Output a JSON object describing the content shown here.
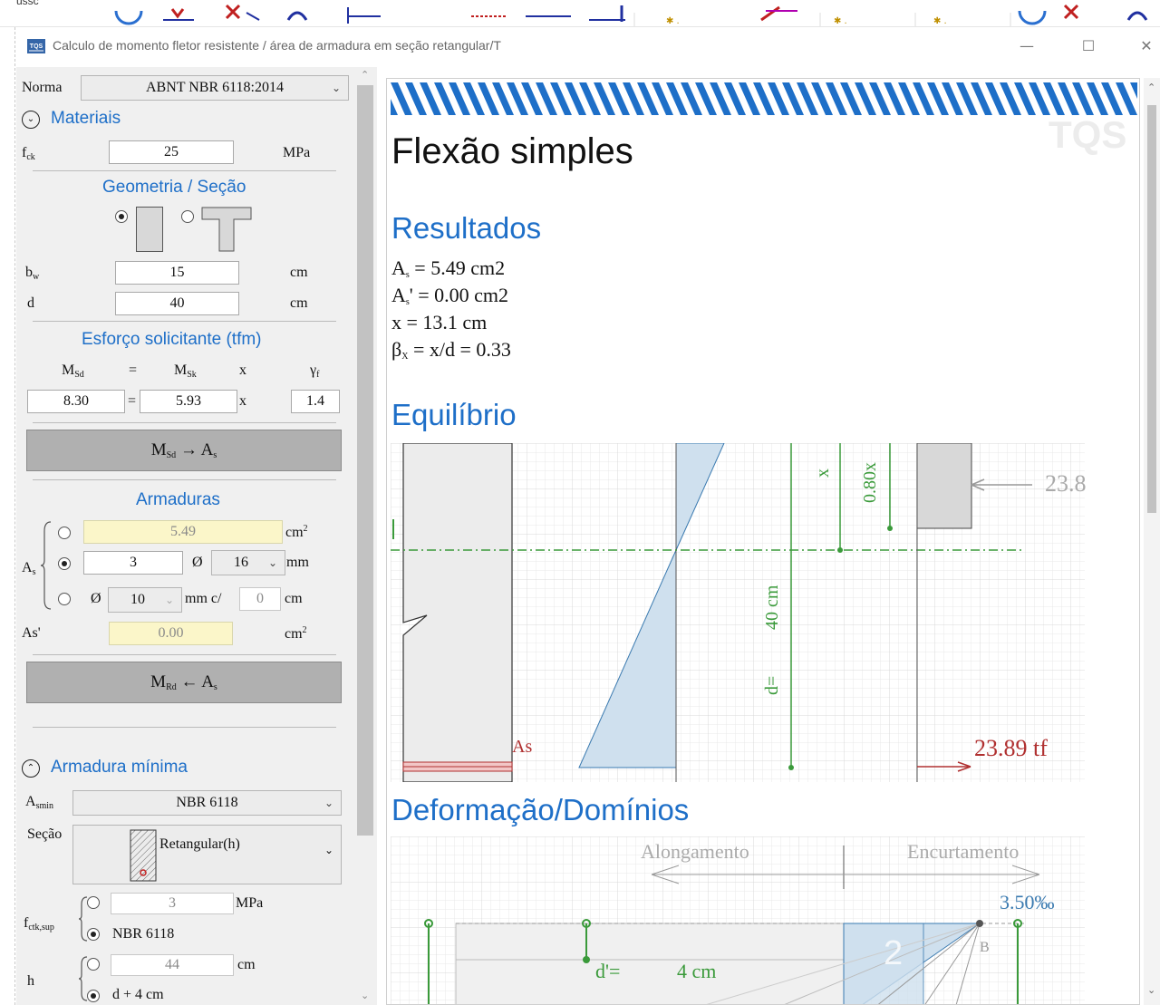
{
  "window": {
    "title": "Calculo de momento fletor resistente / área de armadura em seção retangular/T",
    "top_strip_text": "ussc"
  },
  "norma": {
    "label": "Norma",
    "value": "ABNT NBR 6118:2014"
  },
  "materiais": {
    "header": "Materiais",
    "fck_label": "f",
    "fck_sub": "ck",
    "fck_value": "25",
    "fck_unit": "MPa"
  },
  "geometria": {
    "header": "Geometria / Seção",
    "bw_label": "b",
    "bw_sub": "w",
    "bw_value": "15",
    "bw_unit": "cm",
    "d_label": "d",
    "d_value": "40",
    "d_unit": "cm"
  },
  "esforco": {
    "header": "Esforço solicitante (tfm)",
    "msd_label": "M",
    "msd_sub": "Sd",
    "eq": "=",
    "msk_label": "M",
    "msk_sub": "Sk",
    "x": "x",
    "gamma_label": "γ",
    "gamma_sub": "f",
    "msd_value": "8.30",
    "msk_value": "5.93",
    "gamma_value": "1.4"
  },
  "btn_msd_as": {
    "m": "M",
    "m_sub": "Sd",
    "arrow": "→",
    "a": "A",
    "a_sub": "s"
  },
  "armaduras": {
    "header": "Armaduras",
    "as_label": "A",
    "as_sub": "s",
    "area_value": "5.49",
    "area_unit": "cm",
    "area_unit_sup": "2",
    "bars_count": "3",
    "phi": "Ø",
    "bar_diam": "16",
    "bar_unit": "mm",
    "spacing_phi": "Ø",
    "spacing_diam": "10",
    "spacing_unit": "mm c/",
    "spacing_value": "0",
    "spacing_value_unit": "cm",
    "as_prime_label": "As'",
    "as_prime_value": "0.00",
    "as_prime_unit": "cm",
    "as_prime_unit_sup": "2"
  },
  "btn_mrd_as": {
    "m": "M",
    "m_sub": "Rd",
    "arrow": "←",
    "a": "A",
    "a_sub": "s"
  },
  "armadura_minima": {
    "header": "Armadura mínima",
    "asmin_label": "A",
    "asmin_sub": "smin",
    "asmin_value": "NBR 6118",
    "secao_label": "Seção",
    "secao_value": "Retangular(h)",
    "fctk_label": "f",
    "fctk_sub": "ctk,sup",
    "fctk_value": "3",
    "fctk_unit": "MPa",
    "fctk_option2": "NBR 6118",
    "h_label": "h",
    "h_value": "44",
    "h_unit": "cm",
    "h_option2": "d + 4 cm"
  },
  "doc": {
    "brand": "TQS",
    "title": "Flexão simples",
    "resultados_header": "Resultados",
    "results": {
      "as_lhs": "A",
      "as_sub": "s",
      "as_rhs": " = 5.49 cm2",
      "asp_lhs": "A",
      "asp_sub": "s",
      "asp_rhs": "' = 0.00 cm2",
      "x_line": "x = 13.1 cm",
      "beta_lhs": "β",
      "beta_sub": "X",
      "beta_rhs": " = x/d = 0.33"
    },
    "equilibrio_header": "Equilíbrio",
    "eq_labels": {
      "x": "x",
      "x080": "0.80x",
      "d40": "40 cm",
      "d_eq": "d=",
      "as": "As",
      "force_bottom": "23.89 tf",
      "force_top": "23.8"
    },
    "deformacao_header": "Deformação/Domínios",
    "def_labels": {
      "alongamento": "Alongamento",
      "encurtamento": "Encurtamento",
      "strain": "3.50‰",
      "domain": "2",
      "point_b": "B",
      "d_prime": "d'=",
      "d_prime_value": "4 cm"
    }
  },
  "colors": {
    "accent": "#1e6fc8",
    "green": "#3a9a3a",
    "red": "#b03030",
    "blue_fill": "#cfe0ee",
    "yellow_field": "#fbf6c9"
  }
}
